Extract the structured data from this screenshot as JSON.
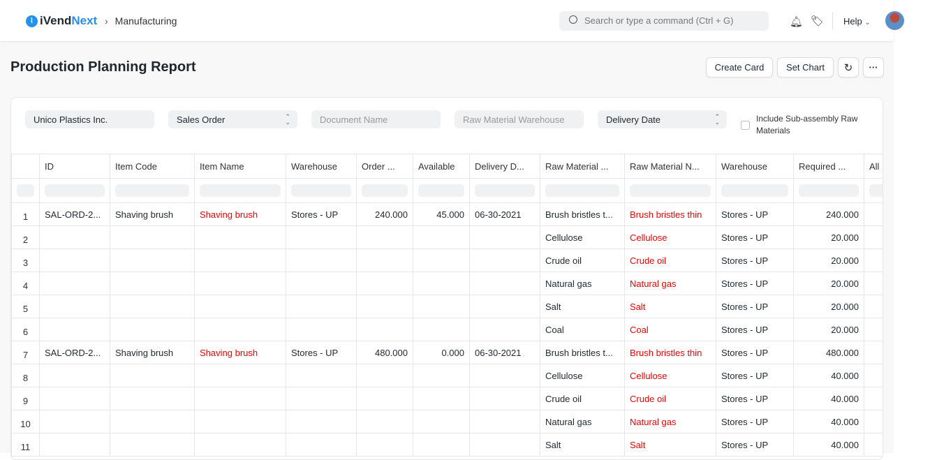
{
  "nav": {
    "brand_a": "iVend",
    "brand_b": "Next",
    "breadcrumb": "Manufacturing",
    "search_placeholder": "Search or type a command (Ctrl + G)",
    "help": "Help"
  },
  "page": {
    "title": "Production Planning Report",
    "create_card": "Create Card",
    "set_chart": "Set Chart",
    "more": "···"
  },
  "filters": {
    "company": "Unico Plastics Inc.",
    "based_on": "Sales Order",
    "document_name": "Document Name",
    "raw_material_warehouse": "Raw Material Warehouse",
    "order_by": "Delivery Date",
    "include_sub_assembly": "Include Sub-assembly Raw Materials",
    "include_checked": false
  },
  "table": {
    "columns": [
      "ID",
      "Item Code",
      "Item Name",
      "Warehouse",
      "Order ...",
      "Available",
      "Delivery D...",
      "Raw Material ...",
      "Raw Material N...",
      "Warehouse",
      "Required ...",
      "All"
    ],
    "rows": [
      [
        "1",
        "SAL-ORD-2...",
        "Shaving brush",
        "Shaving brush",
        "Stores - UP",
        "240.000",
        "45.000",
        "06-30-2021",
        "Brush bristles t...",
        "Brush bristles thin",
        "Stores - UP",
        "240.000"
      ],
      [
        "2",
        "",
        "",
        "",
        "",
        "",
        "",
        "",
        "Cellulose",
        "Cellulose",
        "Stores - UP",
        "20.000"
      ],
      [
        "3",
        "",
        "",
        "",
        "",
        "",
        "",
        "",
        "Crude oil",
        "Crude oil",
        "Stores - UP",
        "20.000"
      ],
      [
        "4",
        "",
        "",
        "",
        "",
        "",
        "",
        "",
        "Natural gas",
        "Natural gas",
        "Stores - UP",
        "20.000"
      ],
      [
        "5",
        "",
        "",
        "",
        "",
        "",
        "",
        "",
        "Salt",
        "Salt",
        "Stores - UP",
        "20.000"
      ],
      [
        "6",
        "",
        "",
        "",
        "",
        "",
        "",
        "",
        "Coal",
        "Coal",
        "Stores - UP",
        "20.000"
      ],
      [
        "7",
        "SAL-ORD-2...",
        "Shaving brush",
        "Shaving brush",
        "Stores - UP",
        "480.000",
        "0.000",
        "06-30-2021",
        "Brush bristles t...",
        "Brush bristles thin",
        "Stores - UP",
        "480.000"
      ],
      [
        "8",
        "",
        "",
        "",
        "",
        "",
        "",
        "",
        "Cellulose",
        "Cellulose",
        "Stores - UP",
        "40.000"
      ],
      [
        "9",
        "",
        "",
        "",
        "",
        "",
        "",
        "",
        "Crude oil",
        "Crude oil",
        "Stores - UP",
        "40.000"
      ],
      [
        "10",
        "",
        "",
        "",
        "",
        "",
        "",
        "",
        "Natural gas",
        "Natural gas",
        "Stores - UP",
        "40.000"
      ],
      [
        "11",
        "",
        "",
        "",
        "",
        "",
        "",
        "",
        "Salt",
        "Salt",
        "Stores - UP",
        "40.000"
      ]
    ]
  }
}
